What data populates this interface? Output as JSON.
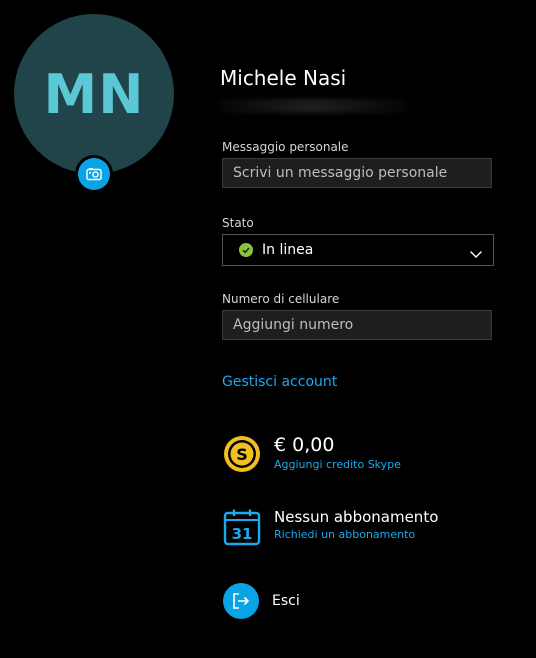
{
  "profile": {
    "initials": "MN",
    "name": "Michele Nasi"
  },
  "fields": {
    "personal_message_label": "Messaggio personale",
    "personal_message_placeholder": "Scrivi un messaggio personale",
    "status_label": "Stato",
    "status_value": "In linea",
    "phone_label": "Numero di cellulare",
    "phone_placeholder": "Aggiungi numero"
  },
  "links": {
    "manage_account": "Gestisci account"
  },
  "credit": {
    "amount": "€ 0,00",
    "action": "Aggiungi credito Skype"
  },
  "subscription": {
    "title": "Nessun abbonamento",
    "action": "Richiedi un abbonamento",
    "calendar_day": "31"
  },
  "signout": {
    "label": "Esci"
  },
  "colors": {
    "accent": "#1ba9f0",
    "avatar_bg": "#21434a",
    "avatar_text": "#5bc8d6",
    "online": "#8ac43f",
    "credit_gold": "#f2c01e"
  },
  "icons": {
    "camera": "camera-icon",
    "status": "online-check-icon",
    "chevron": "chevron-down-icon",
    "credit": "skype-credit-icon",
    "calendar": "calendar-icon",
    "signout": "sign-out-icon"
  }
}
